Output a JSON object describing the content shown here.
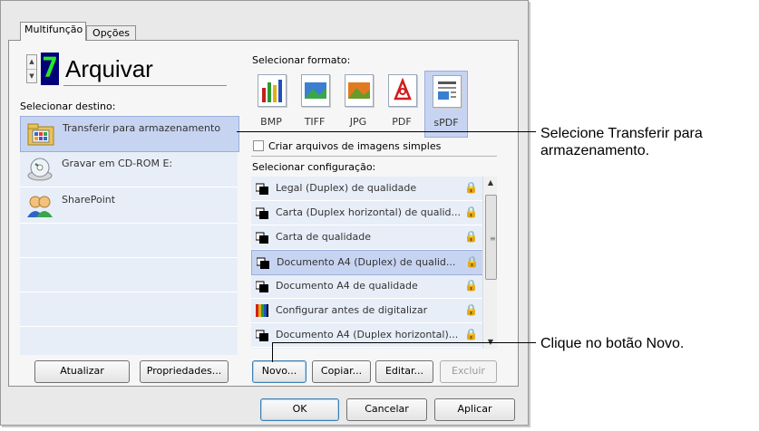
{
  "tabs": [
    {
      "label": "Multifunção"
    },
    {
      "label": "Opções"
    }
  ],
  "mode": {
    "number": "7",
    "title": "Arquivar"
  },
  "destination": {
    "heading": "Selecionar destino:",
    "items": [
      {
        "label": "Transferir para armazenamento",
        "icon": "folder-transfer-icon",
        "selected": true
      },
      {
        "label": "Gravar em CD-ROM  E:",
        "icon": "cd-drive-icon",
        "selected": false
      },
      {
        "label": "SharePoint",
        "icon": "sharepoint-icon",
        "selected": false
      }
    ]
  },
  "format": {
    "heading": "Selecionar formato:",
    "items": [
      {
        "label": "BMP",
        "icon": "bmp-icon"
      },
      {
        "label": "TIFF",
        "icon": "tiff-icon"
      },
      {
        "label": "JPG",
        "icon": "jpg-icon"
      },
      {
        "label": "PDF",
        "icon": "pdf-icon"
      },
      {
        "label": "sPDF",
        "icon": "spdf-icon",
        "selected": true
      }
    ],
    "checkbox_label": "Criar arquivos de imagens simples"
  },
  "config": {
    "heading": "Selecionar configuração:",
    "items": [
      {
        "label": "Legal (Duplex) de qualidade",
        "icon": "scanner-icon",
        "locked": true
      },
      {
        "label": "Carta (Duplex horizontal) de qualid...",
        "icon": "scanner-icon",
        "locked": true
      },
      {
        "label": "Carta de qualidade",
        "icon": "scanner-icon",
        "locked": true
      },
      {
        "label": "Documento A4 (Duplex) de qualid...",
        "icon": "scanner-icon",
        "locked": true,
        "selected": true
      },
      {
        "label": "Documento A4 de qualidade",
        "icon": "scanner-icon",
        "locked": true
      },
      {
        "label": "Configurar antes de digitalizar",
        "icon": "color-bars-icon",
        "locked": true
      },
      {
        "label": "Documento A4 (Duplex horizontal)...",
        "icon": "scanner-icon",
        "locked": true
      }
    ]
  },
  "buttons": {
    "update": "Atualizar",
    "properties": "Propriedades...",
    "new": "Novo...",
    "copy": "Copiar...",
    "edit": "Editar...",
    "delete": "Excluir",
    "ok": "OK",
    "cancel": "Cancelar",
    "apply": "Aplicar"
  },
  "callouts": {
    "select_transfer": "Selecione Transferir para armazenamento.",
    "click_new": "Clique no botão Novo."
  },
  "colors": {
    "selection": "#c7d4f1",
    "list_bg": "#e8eef8",
    "digit": "#28e828",
    "digit_bg": "#00007a"
  }
}
